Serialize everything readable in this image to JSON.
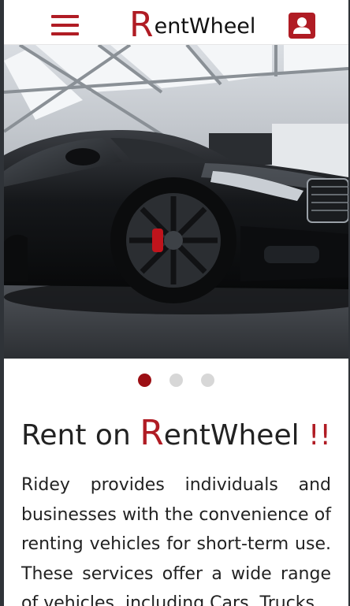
{
  "navbar": {
    "menu_icon": "hamburger-menu-icon",
    "brand_first_letter": "R",
    "brand_rest": "entWheel",
    "profile_icon": "user-profile-icon",
    "accent_color": "#b01c24"
  },
  "hero": {
    "image": "black sports sedan in a glass-roofed garage"
  },
  "carousel": {
    "slide_count": 3,
    "active_index": 0,
    "active_color": "#9c0f14",
    "inactive_color": "#d7d7d7"
  },
  "intro": {
    "heading_prefix": "Rent on ",
    "heading_brand_first": "R",
    "heading_brand_rest": "entWheel",
    "heading_suffix": " !!",
    "description": "Ridey provides individuals and businesses with the convenience of renting vehicles for short-term use. These services offer a wide range of vehicles, including Cars, Trucks,"
  }
}
